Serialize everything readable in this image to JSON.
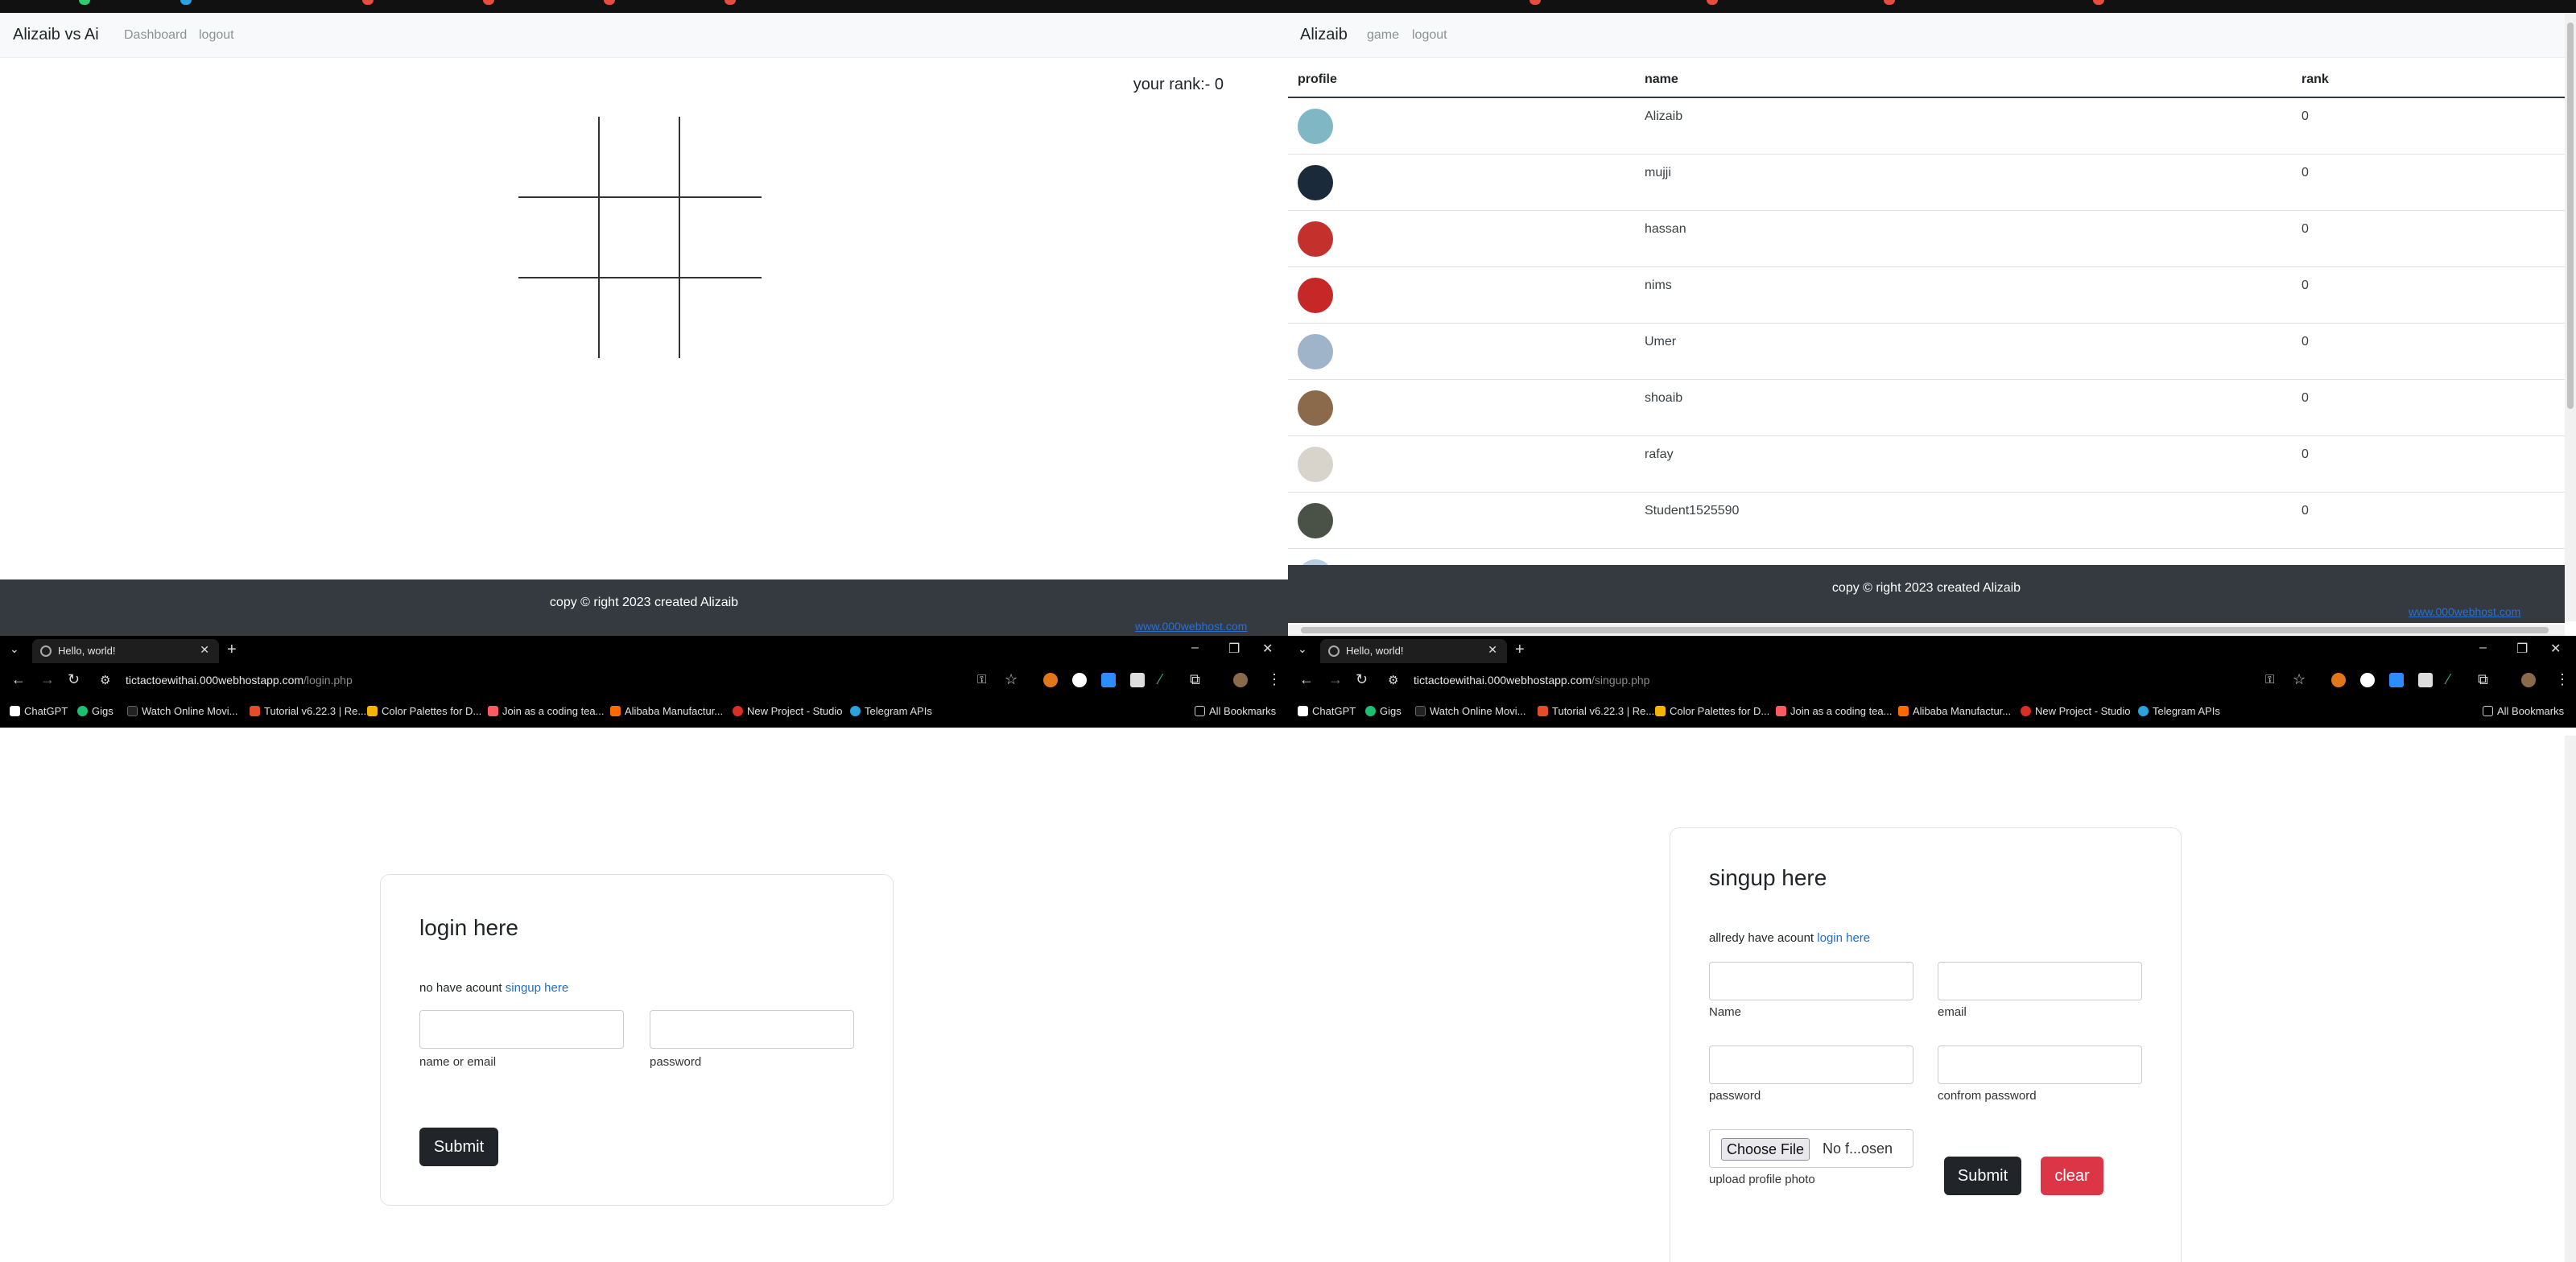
{
  "tl": {
    "brand": "Alizaib vs Ai",
    "nav": [
      "Dashboard",
      "logout"
    ],
    "rank_text": "your rank:- 0",
    "footer": "copy © right 2023 created Alizaib",
    "host_image_alt": "www.000webhost.com"
  },
  "tr": {
    "brand": "Alizaib",
    "nav": [
      "game",
      "logout"
    ],
    "headers": {
      "profile": "profile",
      "name": "name",
      "rank": "rank"
    },
    "rows": [
      {
        "name": "Alizaib",
        "rank": "0"
      },
      {
        "name": "mujji",
        "rank": "0"
      },
      {
        "name": "hassan",
        "rank": "0"
      },
      {
        "name": "nims",
        "rank": "0"
      },
      {
        "name": "Umer",
        "rank": "0"
      },
      {
        "name": "shoaib",
        "rank": "0"
      },
      {
        "name": "rafay",
        "rank": "0"
      },
      {
        "name": "Student1525590",
        "rank": "0"
      }
    ],
    "footer": "copy © right 2023 created Alizaib",
    "host_image_alt": "www.000webhost.com"
  },
  "browser": {
    "tab_title": "Hello, world!",
    "new_tab": "+",
    "host": "tictactoewithai.000webhostapp.com",
    "bookmarks": [
      {
        "label": "ChatGPT",
        "color": "#ffffff"
      },
      {
        "label": "Gigs",
        "color": "#1dbf73"
      },
      {
        "label": "Watch Online Movi...",
        "color": "#222222"
      },
      {
        "label": "Tutorial v6.22.3 | Re...",
        "color": "#e44d26"
      },
      {
        "label": "Color Palettes for D...",
        "color": "#f4b400"
      },
      {
        "label": "Join as a coding tea...",
        "color": "#ff5a5f"
      },
      {
        "label": "Alibaba Manufactur...",
        "color": "#ff6a00"
      },
      {
        "label": "New Project - Studio",
        "color": "#d93025"
      },
      {
        "label": "Telegram APIs",
        "color": "#2aa3df"
      }
    ],
    "all_bookmarks": "All Bookmarks"
  },
  "bl": {
    "path": "/login.php",
    "title": "login here",
    "hint": "no have acount",
    "hint_link": "singup here",
    "labels": [
      "name or email",
      "password"
    ],
    "submit": "Submit"
  },
  "br": {
    "path": "/singup.php",
    "title": "singup here",
    "hint": "allredy have acount",
    "hint_link": "login here",
    "labels": [
      "Name",
      "email",
      "password",
      "confrom password"
    ],
    "file_button": "Choose File",
    "file_text": "No f...osen",
    "file_label": "upload profile photo",
    "submit": "Submit",
    "clear": "clear"
  },
  "avatar_colors": [
    "#7fb8c4",
    "#1b2a3a",
    "#c4302b",
    "#c62828",
    "#9fb4c8",
    "#8a6a4a",
    "#d8d4cc",
    "#4a5248"
  ]
}
